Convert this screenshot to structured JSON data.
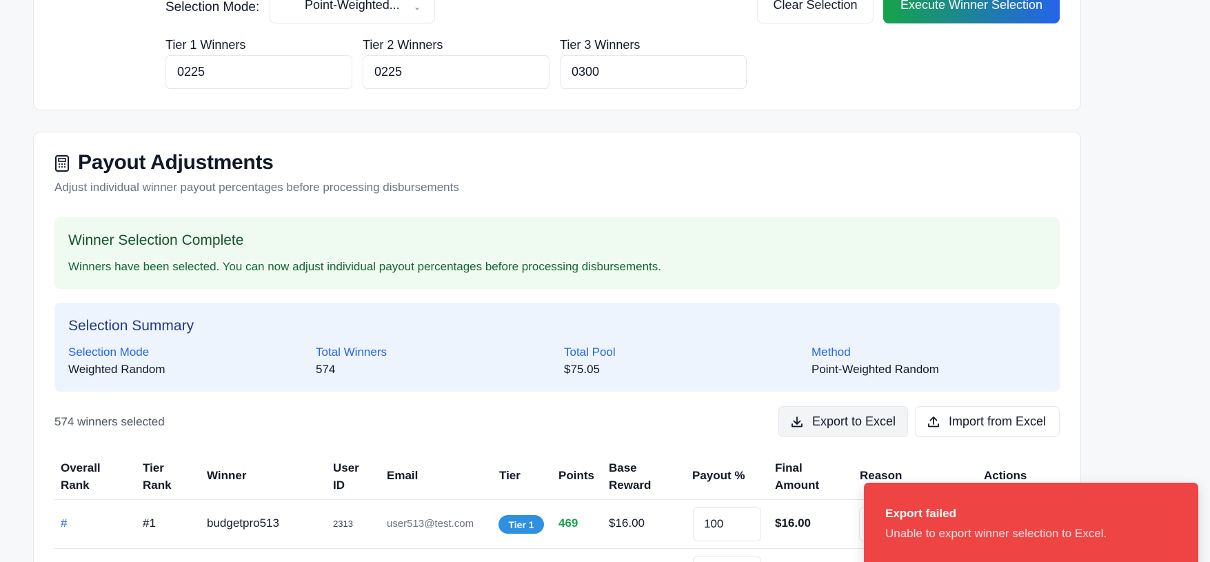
{
  "selection": {
    "mode_label": "Selection Mode:",
    "mode_value": "Point-Weighted...",
    "clear_label": "Clear Selection",
    "execute_label": "Execute Winner Selection",
    "tiers": [
      {
        "label": "Tier 1 Winners",
        "value": "0225"
      },
      {
        "label": "Tier 2 Winners",
        "value": "0225"
      },
      {
        "label": "Tier 3 Winners",
        "value": "0300"
      }
    ]
  },
  "payout": {
    "title": "Payout Adjustments",
    "subtitle": "Adjust individual winner payout percentages before processing disbursements",
    "alert": {
      "title": "Winner Selection Complete",
      "text": "Winners have been selected. You can now adjust individual payout percentages before processing disbursements."
    },
    "summary": {
      "title": "Selection Summary",
      "items": [
        {
          "key": "Selection Mode",
          "value": "Weighted Random"
        },
        {
          "key": "Total Winners",
          "value": "574"
        },
        {
          "key": "Total Pool",
          "value": "$75.05"
        },
        {
          "key": "Method",
          "value": "Point-Weighted Random"
        }
      ]
    },
    "count_text": "574 winners selected",
    "export_label": "Export to Excel",
    "import_label": "Import from Excel",
    "columns": {
      "overall_rank": [
        "Overall",
        "Rank"
      ],
      "tier_rank": [
        "Tier",
        "Rank"
      ],
      "winner": "Winner",
      "user_id": [
        "User",
        "ID"
      ],
      "email": "Email",
      "tier": "Tier",
      "points": "Points",
      "base_reward": [
        "Base",
        "Reward"
      ],
      "payout_pct": "Payout %",
      "final_amount": [
        "Final",
        "Amount"
      ],
      "reason": "Reason",
      "actions": "Actions"
    },
    "rows": [
      {
        "overall_rank": "#",
        "tier_rank": "#1",
        "winner": "budgetpro513",
        "user_id": "2313",
        "email": "user513@test.com",
        "tier": "Tier 1",
        "points": "469",
        "base_reward": "$16.00",
        "payout_pct": "100",
        "final_amount": "$16.00"
      }
    ]
  },
  "toast": {
    "title": "Export failed",
    "text": "Unable to export winner selection to Excel."
  },
  "colors": {
    "primary": "#2563eb",
    "success": "#16a34a",
    "danger": "#ef4444",
    "badge": "#2f8fe0"
  }
}
